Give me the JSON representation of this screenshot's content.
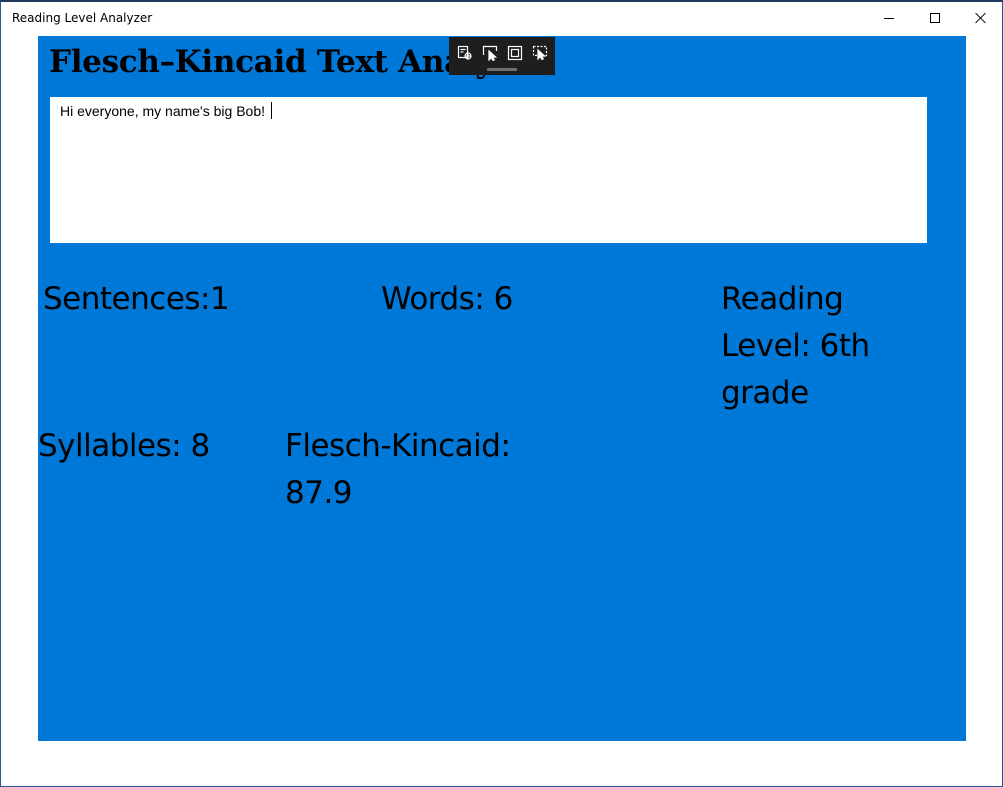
{
  "window": {
    "title": "Reading Level Analyzer"
  },
  "app": {
    "heading": "Flesch–Kincaid Text Analyzer",
    "input_value": "Hi everyone, my name's big Bob!",
    "background_color": "#0078d7"
  },
  "stats": {
    "sentences": "Sentences:1",
    "words": "Words: 6",
    "reading_level": "Reading Level: 6th grade",
    "syllables": "Syllables: 8",
    "flesch_kincaid": "Flesch-Kincaid: 87.9"
  },
  "debug_toolbar": {
    "icons": [
      "live-visual-tree-icon",
      "select-element-icon",
      "display-layout-adorners-icon",
      "track-focused-element-icon"
    ]
  }
}
